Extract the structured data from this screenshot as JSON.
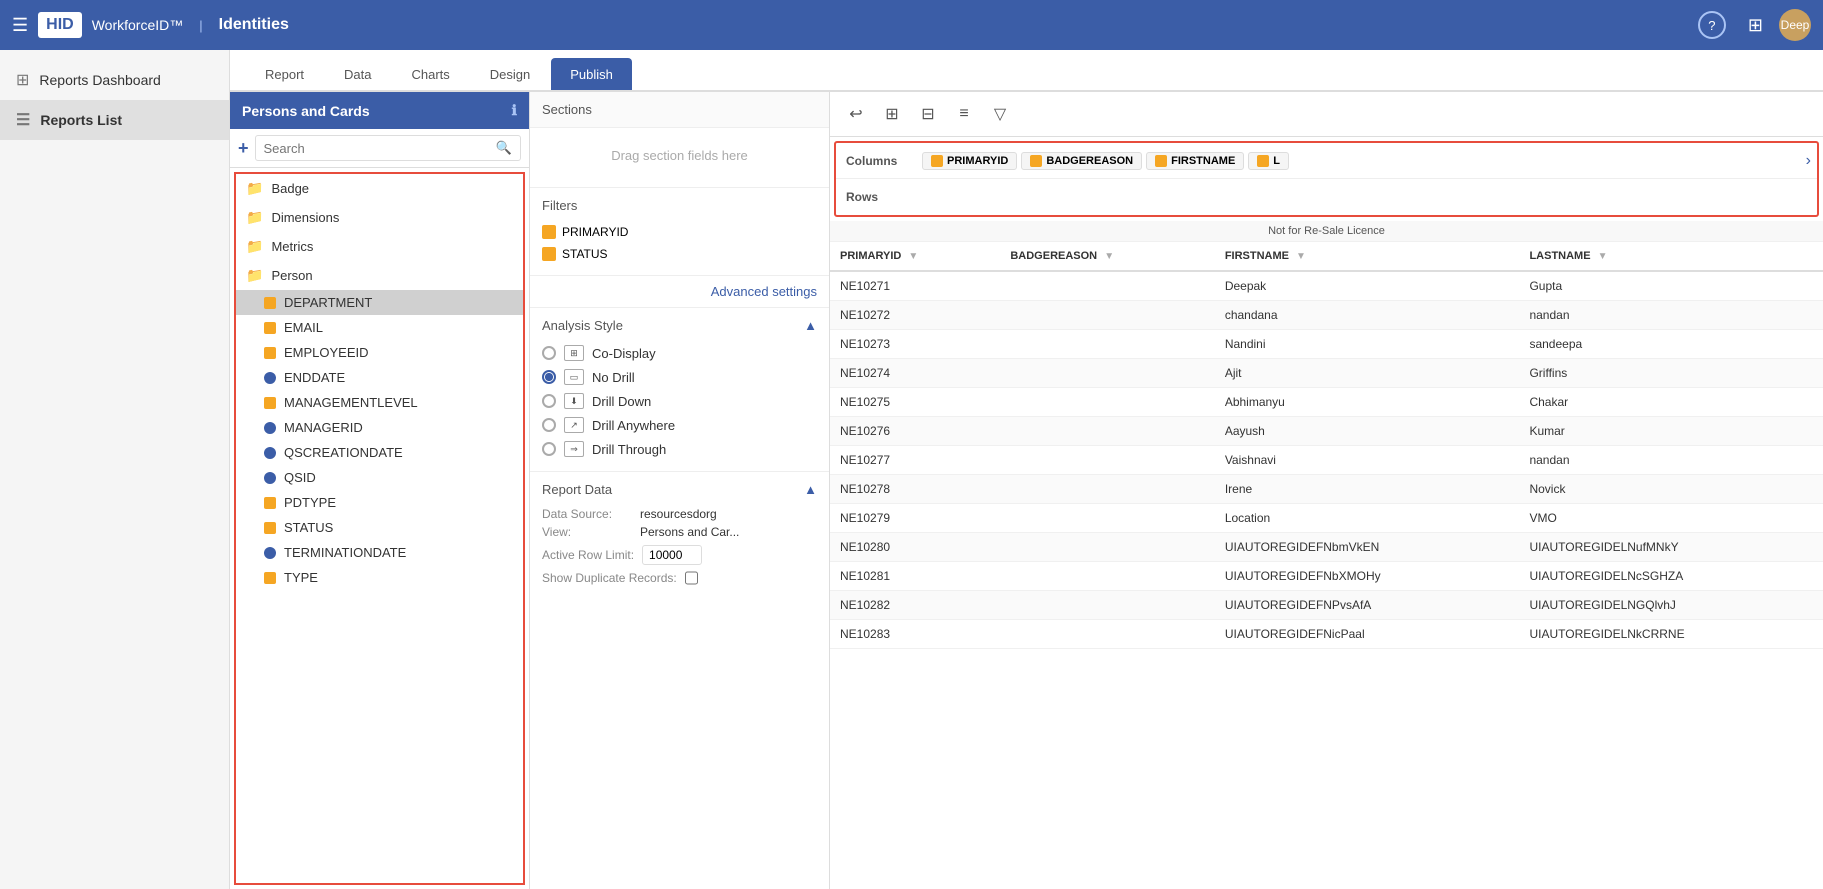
{
  "navbar": {
    "hamburger": "☰",
    "logo": "HID",
    "app_name": "WorkforceID™",
    "divider": "|",
    "module": "Identities",
    "help_icon": "?",
    "grid_icon": "⊞",
    "username": "Deep"
  },
  "sidebar": {
    "items": [
      {
        "id": "reports-dashboard",
        "label": "Reports Dashboard",
        "icon": "⊞"
      },
      {
        "id": "reports-list",
        "label": "Reports List",
        "icon": "☰"
      }
    ]
  },
  "tabs": [
    {
      "id": "report",
      "label": "Report"
    },
    {
      "id": "data",
      "label": "Data"
    },
    {
      "id": "charts",
      "label": "Charts"
    },
    {
      "id": "design",
      "label": "Design"
    },
    {
      "id": "publish",
      "label": "Publish",
      "active": true
    }
  ],
  "left_panel": {
    "title": "Persons and Cards",
    "search_placeholder": "Search",
    "groups": [
      {
        "id": "badge",
        "label": "Badge"
      },
      {
        "id": "dimensions",
        "label": "Dimensions"
      },
      {
        "id": "metrics",
        "label": "Metrics"
      },
      {
        "id": "person",
        "label": "Person"
      }
    ],
    "fields": [
      {
        "id": "department",
        "label": "DEPARTMENT",
        "type": "yellow",
        "selected": true
      },
      {
        "id": "email",
        "label": "EMAIL",
        "type": "yellow"
      },
      {
        "id": "employeeid",
        "label": "EMPLOYEEID",
        "type": "yellow"
      },
      {
        "id": "enddate",
        "label": "ENDDATE",
        "type": "blue"
      },
      {
        "id": "managementlevel",
        "label": "MANAGEMENTLEVEL",
        "type": "yellow"
      },
      {
        "id": "managerid",
        "label": "MANAGERID",
        "type": "blue"
      },
      {
        "id": "qscreationdate",
        "label": "QSCREATIONDATE",
        "type": "blue"
      },
      {
        "id": "qsid",
        "label": "QSID",
        "type": "blue"
      },
      {
        "id": "pdtype",
        "label": "PDTYPE",
        "type": "yellow"
      },
      {
        "id": "status",
        "label": "STATUS",
        "type": "yellow"
      },
      {
        "id": "terminationdate",
        "label": "TERMINATIONDATE",
        "type": "blue"
      },
      {
        "id": "type",
        "label": "TYPE",
        "type": "yellow"
      }
    ]
  },
  "middle_panel": {
    "sections_label": "Sections",
    "drag_hint": "Drag section fields here",
    "filters_label": "Filters",
    "filters": [
      {
        "id": "primaryid",
        "label": "PRIMARYID"
      },
      {
        "id": "status",
        "label": "STATUS"
      }
    ],
    "advanced_settings": "Advanced settings",
    "analysis_style_label": "Analysis Style",
    "analysis_options": [
      {
        "id": "co-display",
        "label": "Co-Display",
        "selected": false
      },
      {
        "id": "no-drill",
        "label": "No Drill",
        "selected": true
      },
      {
        "id": "drill-down",
        "label": "Drill Down",
        "selected": false
      },
      {
        "id": "drill-anywhere",
        "label": "Drill Anywhere",
        "selected": false
      },
      {
        "id": "drill-through",
        "label": "Drill Through",
        "selected": false
      }
    ],
    "report_data_label": "Report Data",
    "data_source_label": "Data Source:",
    "data_source_value": "resourcesdorg",
    "view_label": "View:",
    "view_value": "Persons and Car...",
    "active_row_limit_label": "Active Row Limit:",
    "active_row_limit_value": "10000",
    "show_duplicate_label": "Show Duplicate Records:"
  },
  "grid": {
    "toolbar_buttons": [
      "↩",
      "⊞",
      "⊟",
      "≡",
      "▽"
    ],
    "license_notice": "Not for Re-Sale Licence",
    "columns": [
      {
        "id": "primaryid",
        "label": "PRIMARYID"
      },
      {
        "id": "badgereason",
        "label": "BADGEREASON"
      },
      {
        "id": "firstname",
        "label": "FIRSTNAME"
      },
      {
        "id": "lastname",
        "label": "LASTNAME"
      }
    ],
    "config_columns": [
      "PRIMARYID",
      "BADGEREASON",
      "FIRSTNAME"
    ],
    "rows_label": "Rows",
    "columns_label": "Columns",
    "data": [
      {
        "primaryid": "NE10271",
        "badgereason": "",
        "firstname": "Deepak",
        "lastname": "Gupta"
      },
      {
        "primaryid": "NE10272",
        "badgereason": "",
        "firstname": "chandana",
        "lastname": "nandan"
      },
      {
        "primaryid": "NE10273",
        "badgereason": "",
        "firstname": "Nandini",
        "lastname": "sandeepa"
      },
      {
        "primaryid": "NE10274",
        "badgereason": "",
        "firstname": "Ajit",
        "lastname": "Griffins"
      },
      {
        "primaryid": "NE10275",
        "badgereason": "",
        "firstname": "Abhimanyu",
        "lastname": "Chakar"
      },
      {
        "primaryid": "NE10276",
        "badgereason": "",
        "firstname": "Aayush",
        "lastname": "Kumar"
      },
      {
        "primaryid": "NE10277",
        "badgereason": "",
        "firstname": "Vaishnavi",
        "lastname": "nandan"
      },
      {
        "primaryid": "NE10278",
        "badgereason": "",
        "firstname": "Irene",
        "lastname": "Novick"
      },
      {
        "primaryid": "NE10279",
        "badgereason": "",
        "firstname": "Location",
        "lastname": "VMO"
      },
      {
        "primaryid": "NE10280",
        "badgereason": "",
        "firstname": "UIAUTOREGIDEFNbmVkEN",
        "lastname": "UIAUTOREGIDELNufMNkY"
      },
      {
        "primaryid": "NE10281",
        "badgereason": "",
        "firstname": "UIAUTOREGIDEFNbXMOHy",
        "lastname": "UIAUTOREGIDELNcSGHZA"
      },
      {
        "primaryid": "NE10282",
        "badgereason": "",
        "firstname": "UIAUTOREGIDEFNPvsAfA",
        "lastname": "UIAUTOREGIDELNGQlvhJ"
      },
      {
        "primaryid": "NE10283",
        "badgereason": "",
        "firstname": "UIAUTOREGIDEFNicPaal",
        "lastname": "UIAUTOREGIDELNkCRRNE"
      }
    ]
  }
}
